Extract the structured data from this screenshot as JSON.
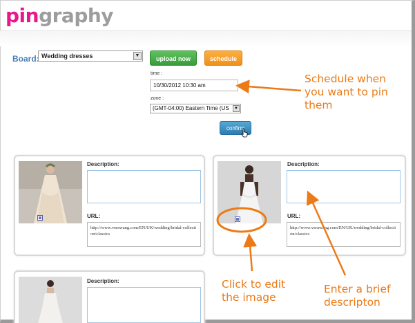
{
  "logo": {
    "part1": "pin",
    "part2": "graphy"
  },
  "toolbar": {
    "board_label": "Board:",
    "board_value": "Wedding dresses",
    "upload_label": "upload now",
    "schedule_label": "schedule"
  },
  "schedule": {
    "time_label": "time :",
    "time_value": "10/30/2012 10:30 am",
    "zone_label": "zone :",
    "zone_value": "(GMT-04:00) Eastern Time (US",
    "confirm_label": "confirm"
  },
  "cards": [
    {
      "desc_label": "Description:",
      "url_label": "URL:",
      "url_value": "http://www.verawang.com/EN/UK/wedding/bridal-collection/classics"
    },
    {
      "desc_label": "Description:",
      "url_label": "URL:",
      "url_value": "http://www.verawang.com/EN/UK/wedding/bridal-collection/classics"
    },
    {
      "desc_label": "Description:"
    }
  ],
  "annotations": {
    "schedule_line1": "Schedule when",
    "schedule_line2": "you want to pin",
    "schedule_line3": "them",
    "edit_line1": "Click to edit",
    "edit_line2": "the image",
    "brief_line1": "Enter a brief",
    "brief_line2": "descripton"
  },
  "colors": {
    "brand_pink": "#e8178a",
    "annotation_orange": "#ec7a16",
    "upload_green": "#4caf50",
    "schedule_orange": "#f7a02d",
    "confirm_blue": "#3a8fc0"
  },
  "icons": {
    "edit": "edit-image-icon",
    "cursor": "hand-cursor-icon",
    "dropdown": "chevron-down-icon"
  }
}
